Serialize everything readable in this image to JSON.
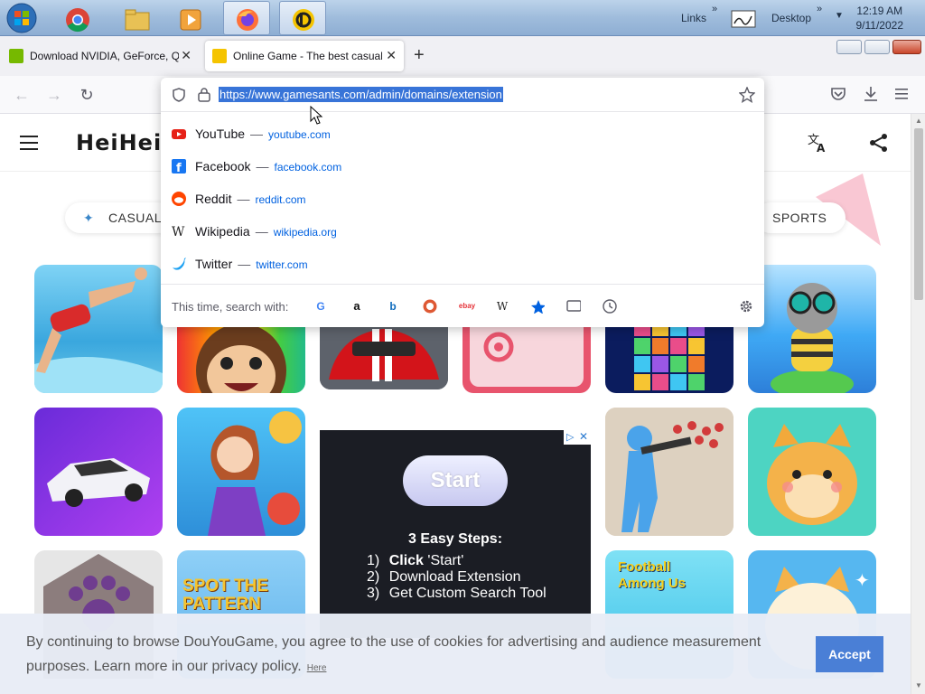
{
  "taskbar": {
    "links_label": "Links",
    "desktop_label": "Desktop",
    "clock_time": "12:19 AM",
    "clock_date": "9/11/2022"
  },
  "tabs": [
    {
      "title": "Download NVIDIA, GeForce, Qu",
      "selected": false
    },
    {
      "title": "Online Game - The best casual",
      "selected": true
    }
  ],
  "urlbar": {
    "url": "https://www.gamesants.com/admin/domains/extension",
    "suggestions": [
      {
        "title": "YouTube",
        "domain": "youtube.com",
        "icon": "youtube-icon"
      },
      {
        "title": "Facebook",
        "domain": "facebook.com",
        "icon": "facebook-icon"
      },
      {
        "title": "Reddit",
        "domain": "reddit.com",
        "icon": "reddit-icon"
      },
      {
        "title": "Wikipedia",
        "domain": "wikipedia.org",
        "icon": "wikipedia-icon"
      },
      {
        "title": "Twitter",
        "domain": "twitter.com",
        "icon": "twitter-icon"
      }
    ],
    "separator": "—",
    "search_with_label": "This time, search with:"
  },
  "site": {
    "logo": "HeiHei",
    "categories": {
      "casual": "CASUAL",
      "sports": "SPORTS"
    }
  },
  "ad": {
    "start_label": "Start",
    "steps_title": "3 Easy Steps:",
    "step1_num": "1)",
    "step1_bold": "Click",
    "step1_rest": "'Start'",
    "step2_num": "2)",
    "step2_text": "Download Extension",
    "step3_num": "3)",
    "step3_text": "Get Custom Search Tool"
  },
  "cookie": {
    "text": "By continuing to browse DouYouGame, you agree to the use of cookies for advertising and audience measurement purposes. Learn more in our privacy policy.",
    "link_label": "Here",
    "accept_label": "Accept"
  },
  "tiles": {
    "spot_pattern": "SPOT THE PATTERN",
    "football_among_us": "Football Among Us"
  },
  "colors": {
    "accent": "#3874d8",
    "accept_button": "#4a7fd6",
    "link_blue": "#0061e0"
  }
}
